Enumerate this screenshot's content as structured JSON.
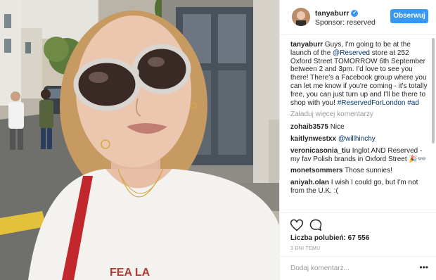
{
  "post": {
    "image_alt": "Selfie of a woman with sunglasses on a street",
    "shirt_text": "FEA LA"
  },
  "header": {
    "username": "tanyaburr",
    "verified_icon": "check-badge-icon",
    "sponsor_label": "Sponsor: reserved",
    "follow_label": "Obserwuj"
  },
  "caption": {
    "username": "tanyaburr",
    "text_1": " Guys, I'm going to be at the launch of the ",
    "mention": "@Reserved",
    "text_2": " store at 252 Oxford Street TOMORROW 6th September between 2 and 3pm. I'd love to see you there! There's a Facebook group where you can let me know if you're coming - it's totally free, you can just turn up and I'll be there to shop with you! ",
    "hashtag_1": "#ReservedForLondon",
    "hashtag_2": "#ad"
  },
  "load_more_label": "Załaduj więcej komentarzy",
  "comments": [
    {
      "user": "zohaib3575",
      "text": " Nice"
    },
    {
      "user": "kaitlynwestxx",
      "text": " ",
      "mention": "@willhinchy"
    },
    {
      "user": "veronicasonia_tiu",
      "text": " Inglot AND Reserved - my fav Polish brands in Oxford Street 🎉👓"
    },
    {
      "user": "monetsommers",
      "text": " Those sunnies!"
    },
    {
      "user": "aniyah.olan",
      "text": " I wish I could go, but I'm not from the U.K. :("
    }
  ],
  "actions": {
    "like_icon": "heart-icon",
    "comment_icon": "speech-bubble-icon",
    "likes_label": "Liczba polubień: 67 556",
    "timestamp": "3 DNI TEMU"
  },
  "comment_box": {
    "placeholder": "Dodaj komentarz...",
    "more_label": "•••"
  },
  "colors": {
    "accent": "#3897f0",
    "link": "#003569",
    "muted": "#999999"
  }
}
